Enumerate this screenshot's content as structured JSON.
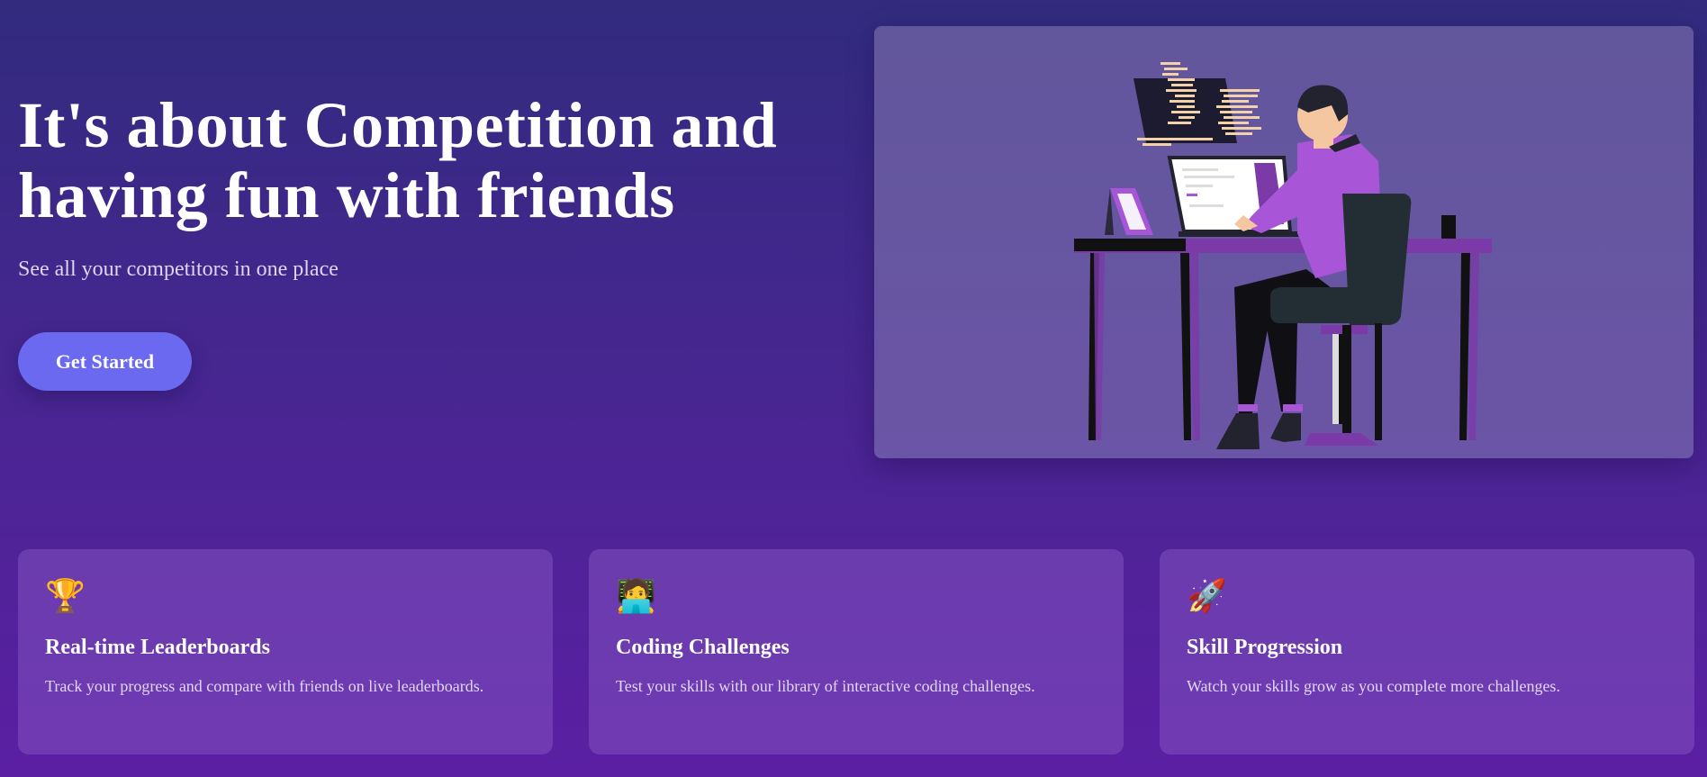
{
  "hero": {
    "title": "It's about Competition and\nhaving fun with friends",
    "subtitle": "See all your competitors in one place",
    "cta_label": "Get Started"
  },
  "illustration": {
    "icon": "developer-at-desk-illustration"
  },
  "features": [
    {
      "icon": "trophy-icon",
      "emoji": "🏆",
      "title": "Real-time Leaderboards",
      "description": "Track your progress and compare with friends on live leaderboards."
    },
    {
      "icon": "technologist-icon",
      "emoji": "🧑‍💻",
      "title": "Coding Challenges",
      "description": "Test your skills with our library of interactive coding challenges."
    },
    {
      "icon": "rocket-icon",
      "emoji": "🚀",
      "title": "Skill Progression",
      "description": "Watch your skills grow as you complete more challenges."
    }
  ],
  "colors": {
    "background_top": "#312b7e",
    "background_bottom": "#5b1fa3",
    "button": "#6b69f0",
    "accent_purple": "#a855d8"
  }
}
